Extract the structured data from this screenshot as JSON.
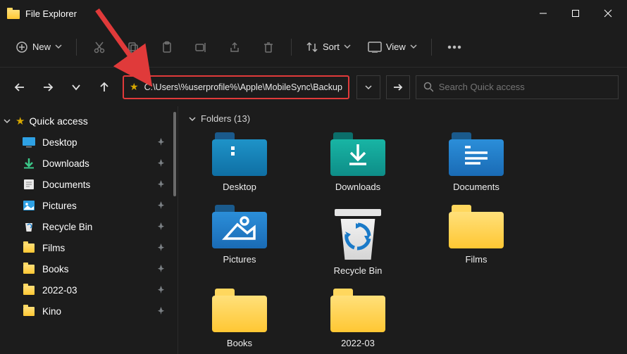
{
  "window": {
    "title": "File Explorer"
  },
  "toolbar": {
    "new_label": "New",
    "sort_label": "Sort",
    "view_label": "View"
  },
  "address": {
    "path": "C:\\Users\\%userprofile%\\Apple\\MobileSync\\Backup"
  },
  "search": {
    "placeholder": "Search Quick access"
  },
  "sidebar": {
    "header": "Quick access",
    "items": [
      {
        "label": "Desktop",
        "icon": "desktop",
        "pinned": true
      },
      {
        "label": "Downloads",
        "icon": "downloads",
        "pinned": true
      },
      {
        "label": "Documents",
        "icon": "documents",
        "pinned": true
      },
      {
        "label": "Pictures",
        "icon": "pictures",
        "pinned": true
      },
      {
        "label": "Recycle Bin",
        "icon": "recycle",
        "pinned": true
      },
      {
        "label": "Films",
        "icon": "folder",
        "pinned": true
      },
      {
        "label": "Books",
        "icon": "folder",
        "pinned": true
      },
      {
        "label": "2022-03",
        "icon": "folder",
        "pinned": true
      },
      {
        "label": "Kino",
        "icon": "folder",
        "pinned": true
      }
    ]
  },
  "content": {
    "section_label": "Folders (13)",
    "items": [
      {
        "label": "Desktop",
        "kind": "desktop"
      },
      {
        "label": "Downloads",
        "kind": "downloads"
      },
      {
        "label": "Documents",
        "kind": "documents"
      },
      {
        "label": "Pictures",
        "kind": "pictures"
      },
      {
        "label": "Recycle Bin",
        "kind": "recycle"
      },
      {
        "label": "Films",
        "kind": "folder"
      },
      {
        "label": "Books",
        "kind": "folder"
      },
      {
        "label": "2022-03",
        "kind": "folder"
      }
    ]
  }
}
